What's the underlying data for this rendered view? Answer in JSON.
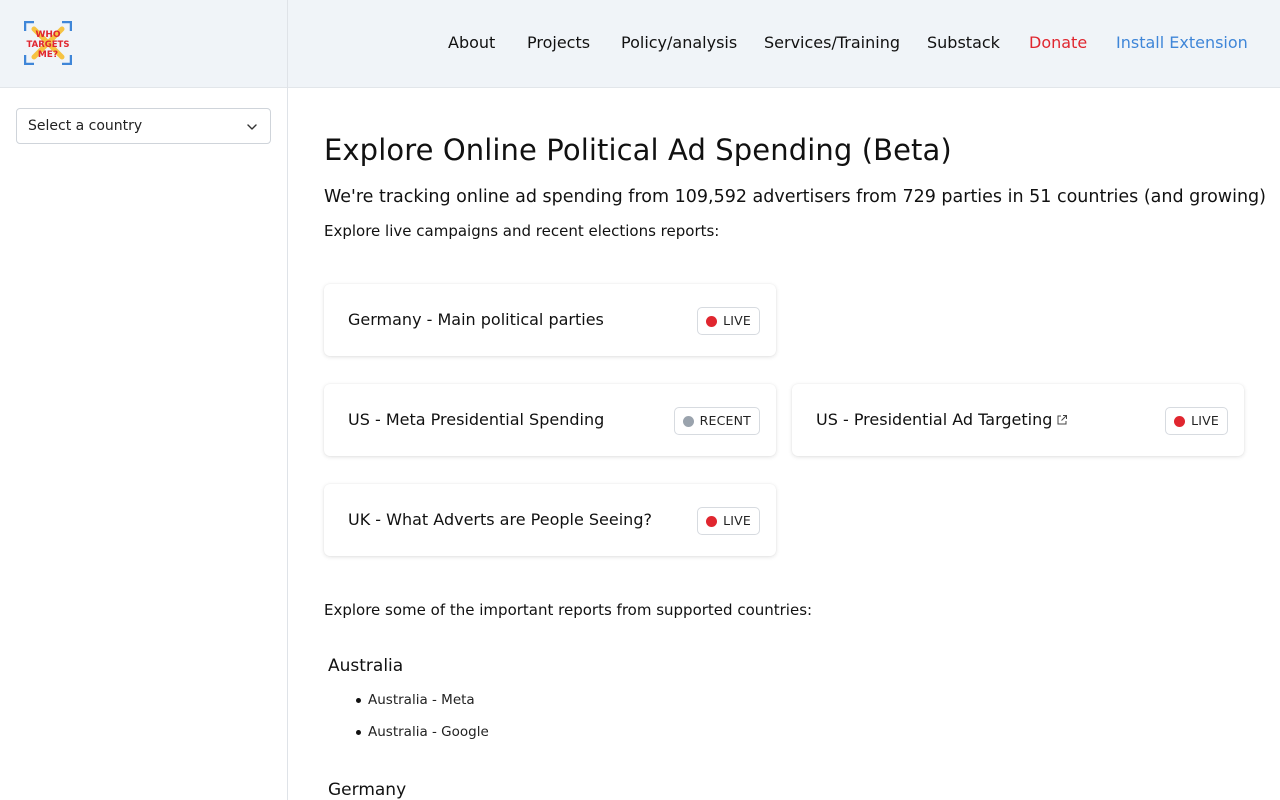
{
  "header": {
    "logo": {
      "text": "WHO TARGETS ME?"
    },
    "nav": [
      {
        "label": "About"
      },
      {
        "label": "Projects"
      },
      {
        "label": "Policy/analysis"
      },
      {
        "label": "Services/Training"
      },
      {
        "label": "Substack"
      },
      {
        "label": "Donate",
        "color": "#e0262f"
      },
      {
        "label": "Install Extension",
        "color": "#3f86d8"
      }
    ]
  },
  "sidebar": {
    "country_select": {
      "value": "Select a country",
      "icon": "chevron-down-icon"
    }
  },
  "main": {
    "title": "Explore Online Political Ad Spending (Beta)",
    "subtitle": "We're tracking online ad spending from 109,592 advertisers from 729 parties in 51 countries (and growing)",
    "live_intro": "Explore live campaigns and recent elections reports:",
    "cards": [
      {
        "title": "Germany - Main political parties",
        "badge": "LIVE",
        "status_color": "#e0262f"
      },
      {
        "title": "US - Meta Presidential Spending",
        "badge": "RECENT",
        "status_color": "#9aa3ad"
      },
      {
        "title": "US - Presidential Ad Targeting",
        "badge": "LIVE",
        "status_color": "#e0262f",
        "external_icon": "external-link-icon"
      },
      {
        "title": "UK - What Adverts are People Seeing?",
        "badge": "LIVE",
        "status_color": "#e0262f"
      }
    ],
    "reports_intro": "Explore some of the important reports from supported countries:",
    "countries": [
      {
        "name": "Australia",
        "reports": [
          "Australia - Meta",
          "Australia - Google"
        ]
      },
      {
        "name": "Germany",
        "reports": []
      }
    ]
  }
}
